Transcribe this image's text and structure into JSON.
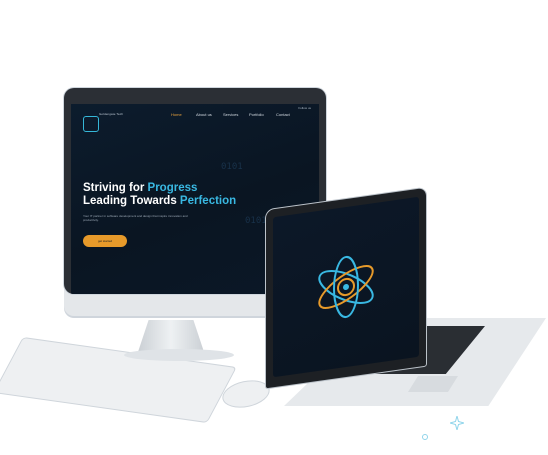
{
  "monitor": {
    "nav": {
      "logo_text": "Goldengate Tech",
      "items": [
        {
          "label": "Home",
          "active": true
        },
        {
          "label": "About us",
          "active": false
        },
        {
          "label": "Services",
          "active": false
        },
        {
          "label": "Portfolio",
          "active": false
        },
        {
          "label": "Contact",
          "active": false
        }
      ],
      "contacts": "Follow us"
    },
    "hero": {
      "headline_line1_prefix": "Striving for ",
      "headline_line1_accent": "Progress",
      "headline_line2_prefix": "Leading Towards ",
      "headline_line2_accent": "Perfection",
      "subtext": "Your IT partner in software development and design that inspire innovation and productivity.",
      "cta_label": "get started"
    },
    "circuit_texts": [
      "0101",
      "0101"
    ]
  },
  "colors": {
    "accent_blue": "#39b8e2",
    "accent_orange": "#e79a2a",
    "screen_dark": "#0c1c2d"
  },
  "laptop": {
    "logo_icon": "atom-logo-icon"
  }
}
